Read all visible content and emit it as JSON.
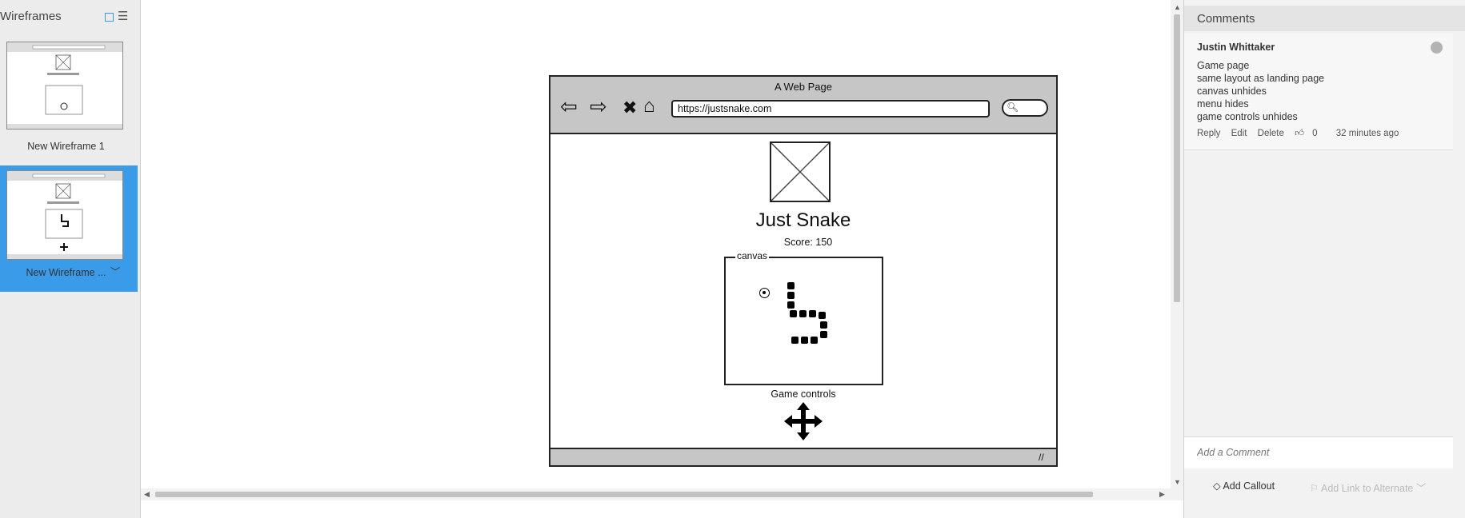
{
  "left_panel": {
    "title": "Wireframes",
    "items": [
      {
        "label": "New Wireframe 1",
        "selected": false
      },
      {
        "label": "New Wireframe ...",
        "selected": true
      }
    ]
  },
  "wireframe": {
    "window_title": "A Web Page",
    "url": "https://justsnake.com",
    "heading": "Just Snake",
    "score": "Score: 150",
    "canvas_label": "canvas",
    "controls_label": "Game controls"
  },
  "comments": {
    "title": "Comments",
    "author": "Justin Whittaker",
    "lines": [
      "Game page",
      "same layout as landing page",
      "canvas unhides",
      "menu hides",
      "game controls unhides"
    ],
    "actions": {
      "reply": "Reply",
      "edit": "Edit",
      "delete": "Delete",
      "likes": "0",
      "time": "32 minutes ago"
    },
    "add_placeholder": "Add a Comment",
    "add_callout": "Add Callout",
    "add_link": "Add Link to Alternate"
  },
  "colors": {
    "selection": "#3a9be8",
    "browser_chrome": "#c6c6c6"
  }
}
